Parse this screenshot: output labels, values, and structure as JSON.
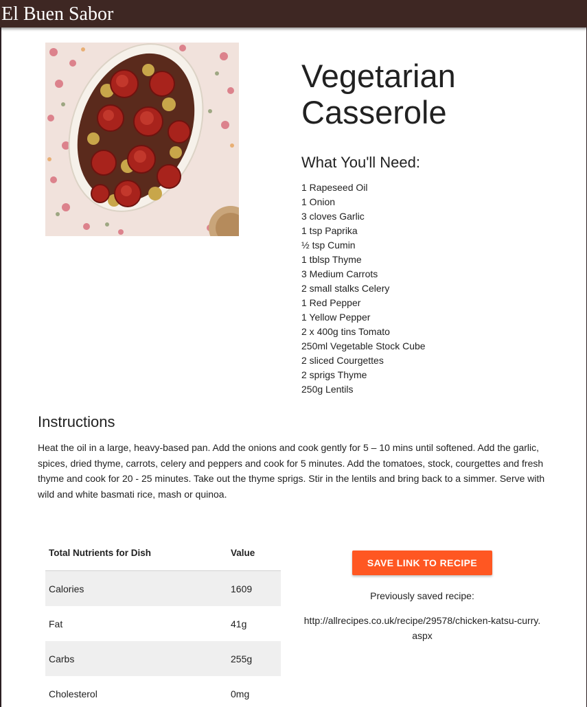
{
  "app": {
    "brand": "El Buen Sabor"
  },
  "recipe": {
    "title": "Vegetarian Casserole",
    "ingredients_heading": "What You'll Need:",
    "ingredients": [
      "1 Rapeseed Oil",
      "1 Onion",
      "3 cloves Garlic",
      "1 tsp Paprika",
      "½ tsp Cumin",
      "1 tblsp Thyme",
      "3 Medium Carrots",
      "2 small stalks Celery",
      "1 Red Pepper",
      "1 Yellow Pepper",
      "2 x 400g tins Tomato",
      "250ml Vegetable Stock Cube",
      "2 sliced Courgettes",
      "2 sprigs Thyme",
      "250g Lentils"
    ],
    "instructions_heading": "Instructions",
    "instructions": "Heat the oil in a large, heavy-based pan. Add the onions and cook gently for 5 – 10 mins until softened. Add the garlic, spices, dried thyme, carrots, celery and peppers and cook for 5 minutes. Add the tomatoes, stock, courgettes and fresh thyme and cook for 20 - 25 minutes. Take out the thyme sprigs. Stir in the lentils and bring back to a simmer. Serve with wild and white basmati rice, mash or quinoa."
  },
  "nutrients": {
    "headers": [
      "Total Nutrients for Dish",
      "Value"
    ],
    "rows": [
      {
        "name": "Calories",
        "value": "1609"
      },
      {
        "name": "Fat",
        "value": "41g"
      },
      {
        "name": "Carbs",
        "value": "255g"
      },
      {
        "name": "Cholesterol",
        "value": "0mg"
      }
    ]
  },
  "save": {
    "button_label": "SAVE LINK TO RECIPE",
    "saved_label": "Previously saved recipe:",
    "saved_url": "http://allrecipes.co.uk/recipe/29578/chicken-katsu-curry.aspx"
  },
  "colors": {
    "topbar": "#3e2723",
    "accent": "#ff5722",
    "row_shade": "#efefef"
  }
}
